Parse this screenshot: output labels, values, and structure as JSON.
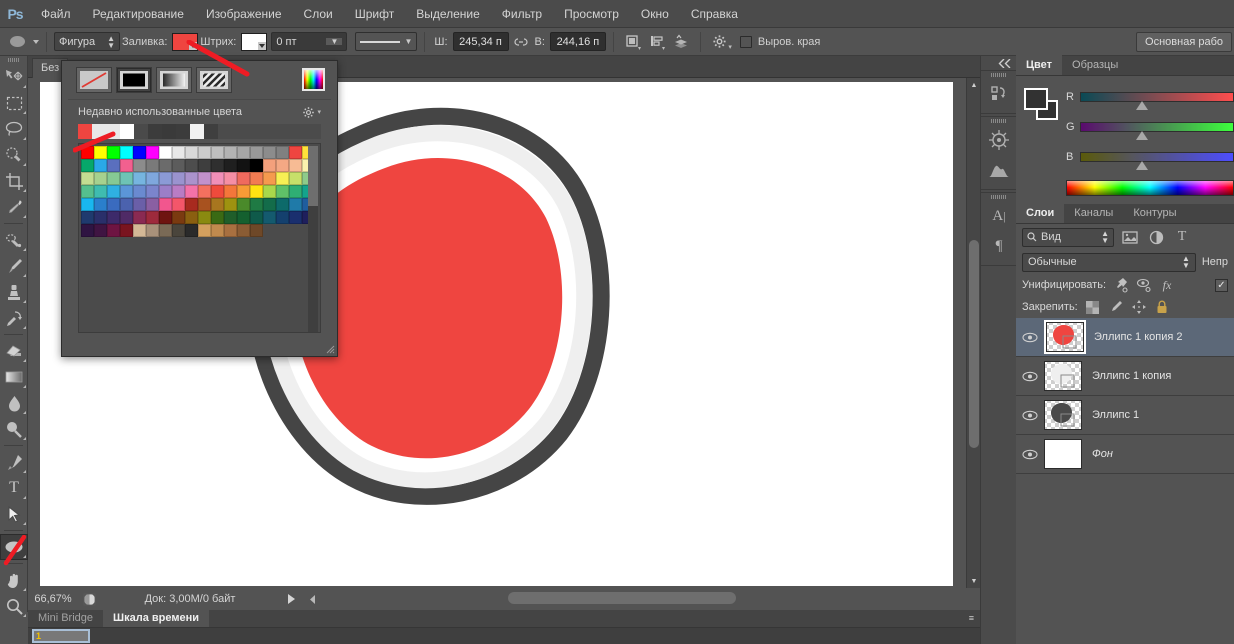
{
  "app": {
    "logo": "Ps"
  },
  "menubar": {
    "items": [
      {
        "label": "Файл"
      },
      {
        "label": "Редактирование"
      },
      {
        "label": "Изображение"
      },
      {
        "label": "Слои"
      },
      {
        "label": "Шрифт"
      },
      {
        "label": "Выделение"
      },
      {
        "label": "Фильтр"
      },
      {
        "label": "Просмотр"
      },
      {
        "label": "Окно"
      },
      {
        "label": "Справка"
      }
    ]
  },
  "options": {
    "tool_icon": "ellipse-tool-icon",
    "mode": "Фигура",
    "fill_label": "Заливка:",
    "fill_color": "#ef4540",
    "stroke_label": "Штрих:",
    "stroke_color": "#ffffff",
    "stroke_width": "0 пт",
    "stroke_style_icon": "stroke-style-icon",
    "width_label": "Ш:",
    "width_value": "245,34 п",
    "link_icon": "link-icon",
    "height_label": "В:",
    "height_value": "244,16 п",
    "path_op_icon": "path-operations-icon",
    "align_icon": "path-align-icon",
    "arrange_icon": "path-arrange-icon",
    "gear_icon": "gear-icon",
    "align_edges_label": "Выров. края",
    "workspace": "Основная рабо"
  },
  "toolbar": {
    "tools": [
      {
        "name": "move-tool",
        "glyph": "move"
      },
      {
        "name": "marquee-tool",
        "glyph": "marquee"
      },
      {
        "name": "lasso-tool",
        "glyph": "lasso"
      },
      {
        "name": "quick-selection-tool",
        "glyph": "quickselect"
      },
      {
        "name": "crop-tool",
        "glyph": "crop"
      },
      {
        "name": "eyedropper-tool",
        "glyph": "eyedropper"
      },
      {
        "name": "healing-brush-tool",
        "glyph": "healing"
      },
      {
        "name": "brush-tool",
        "glyph": "brush"
      },
      {
        "name": "clone-stamp-tool",
        "glyph": "stamp"
      },
      {
        "name": "history-brush-tool",
        "glyph": "historybrush"
      },
      {
        "name": "eraser-tool",
        "glyph": "eraser"
      },
      {
        "name": "gradient-tool",
        "glyph": "gradient"
      },
      {
        "name": "blur-tool",
        "glyph": "blur"
      },
      {
        "name": "dodge-tool",
        "glyph": "dodge"
      },
      {
        "name": "pen-tool",
        "glyph": "pen"
      },
      {
        "name": "type-tool",
        "glyph": "type"
      },
      {
        "name": "path-selection-tool",
        "glyph": "pathselect"
      },
      {
        "name": "ellipse-tool",
        "glyph": "ellipse",
        "active": true
      },
      {
        "name": "hand-tool",
        "glyph": "hand"
      },
      {
        "name": "zoom-tool",
        "glyph": "zoom"
      }
    ]
  },
  "document": {
    "tab_title": "Без",
    "canvas_bg": "#ffffff",
    "shape": {
      "outer_ring_color": "#454545",
      "mid_ring_color": "#efefef",
      "inner_fill_color": "#ef4540"
    }
  },
  "statusbar": {
    "zoom": "66,67%",
    "preview_icon": "doc-preview-icon",
    "doc_info": "Док: 3,00М/0 байт",
    "play_icon": "play-icon",
    "more_icon": "more-icon"
  },
  "rail": {
    "collapse_icon": "collapse-panels-icon",
    "groups": [
      {
        "icons": [
          {
            "name": "history-icon"
          }
        ]
      },
      {
        "icons": [
          {
            "name": "navigator-icon"
          },
          {
            "name": "histogram-icon"
          }
        ]
      },
      {
        "icons": [
          {
            "name": "character-icon",
            "glyph": "A"
          },
          {
            "name": "paragraph-icon",
            "glyph": "¶"
          }
        ]
      }
    ]
  },
  "color_panel": {
    "tabs": [
      {
        "label": "Цвет",
        "selected": true
      },
      {
        "label": "Образцы",
        "selected": false
      }
    ],
    "foreground": "#323232",
    "background": "#323232",
    "sliders": [
      {
        "label": "R",
        "pos": 36
      },
      {
        "label": "G",
        "pos": 36
      },
      {
        "label": "B",
        "pos": 36
      }
    ]
  },
  "layers_panel": {
    "tabs": [
      {
        "label": "Слои",
        "selected": true
      },
      {
        "label": "Каналы",
        "selected": false
      },
      {
        "label": "Контуры",
        "selected": false
      }
    ],
    "filter_label": "Вид",
    "filter_icons": [
      "image-filter-icon",
      "adjustment-filter-icon",
      "type-filter-icon"
    ],
    "blend_mode": "Обычные",
    "opacity_label": "Непр",
    "unify_label": "Унифицировать:",
    "unify_icons": [
      "unify-position-icon",
      "unify-visibility-icon",
      "unify-style-icon"
    ],
    "lock_label": "Закрепить:",
    "lock_icons": [
      "lock-transparency-icon",
      "lock-paint-icon",
      "lock-position-icon",
      "lock-all-icon"
    ],
    "layers": [
      {
        "name": "Эллипс 1 копия 2",
        "selected": true,
        "thumb": "red",
        "visible": true,
        "italic": false
      },
      {
        "name": "Эллипс 1 копия",
        "selected": false,
        "thumb": "white",
        "visible": true,
        "italic": false
      },
      {
        "name": "Эллипс 1",
        "selected": false,
        "thumb": "dark",
        "visible": true,
        "italic": false
      },
      {
        "name": "Фон",
        "selected": false,
        "thumb": "bg",
        "visible": true,
        "italic": true
      }
    ]
  },
  "color_popup": {
    "buttons": [
      {
        "name": "no-fill-button",
        "type": "none",
        "active": false
      },
      {
        "name": "solid-color-button",
        "type": "solid",
        "active": true
      },
      {
        "name": "gradient-button",
        "type": "gradient",
        "active": false
      },
      {
        "name": "pattern-button",
        "type": "pattern",
        "active": false
      }
    ],
    "picker_icon": "color-picker-icon",
    "recent_title": "Недавно использованные цвета",
    "gear_icon": "gear-icon",
    "recent_colors": [
      "#ef4540",
      "#e8e8e8",
      "#e8e8e8",
      "#ffffff",
      "#4a4a4a",
      "#3c3c3c",
      "#3a3a3a",
      "#3c3c3c",
      "#f2f2f2",
      "#3f3f3f"
    ],
    "swatch_rows": [
      [
        "#ff0000",
        "#ffff00",
        "#00ff00",
        "#00ffff",
        "#0000ff",
        "#ff00ff",
        "#ffffff",
        "#e8e8e8",
        "#d8d8d8",
        "#cccccc",
        "#bfbfbf",
        "#b3b3b3",
        "#a6a6a6",
        "#999999",
        "#8c8c8c",
        "#808080",
        "#ef4540",
        "#ffe13a"
      ],
      [
        "#06a86a",
        "#2aa8e8",
        "#5a6fbe",
        "#f2608f",
        "#8c8c8c",
        "#7a7a7a",
        "#6b6b6b",
        "#5c5c5c",
        "#4d4d4d",
        "#3e3e3e",
        "#2f2f2f",
        "#1f1f1f",
        "#121212",
        "#000000",
        "#f4a07c",
        "#f4a884",
        "#f7bb94",
        "#fbf2ae"
      ],
      [
        "#c3dd92",
        "#a6d18f",
        "#86c994",
        "#6ec3b5",
        "#76b5e0",
        "#7fa7dd",
        "#8b9ad6",
        "#9a93cf",
        "#ab92cc",
        "#c291cb",
        "#f08fb8",
        "#f58ea4",
        "#ef6a5e",
        "#f27c52",
        "#f59a4e",
        "#f7ef54",
        "#c7e06a",
        "#8ecb8a"
      ],
      [
        "#55bf8e",
        "#3fbcb0",
        "#2fb0e2",
        "#5b96d8",
        "#6a8ad0",
        "#7b84cc",
        "#9b7ec8",
        "#b97cc4",
        "#f472a8",
        "#f4705f",
        "#ef4a3c",
        "#f4763a",
        "#f79b36",
        "#ffe312",
        "#a9d84b",
        "#5fc168",
        "#2fae74",
        "#14a38c"
      ],
      [
        "#19b7ef",
        "#2a7fcc",
        "#3a6bbf",
        "#4b62ae",
        "#6a5fa8",
        "#8a5fa2",
        "#f2568e",
        "#f4566a",
        "#a82a1f",
        "#a8521f",
        "#a8761f",
        "#9e9210",
        "#4a8a2a",
        "#1f7a44",
        "#136c4a",
        "#0d6a6a",
        "#1f7aa8",
        "#1f5d9e"
      ],
      [
        "#1f3a6e",
        "#2a2f6a",
        "#3d2a6a",
        "#4f2a66",
        "#8a2a52",
        "#9e2a3c",
        "#6e1410",
        "#7a3a10",
        "#8a5f10",
        "#8a8a10",
        "#3a6a14",
        "#1f5e2a",
        "#14602f",
        "#0f5a4a",
        "#145a6e",
        "#14406e",
        "#1a2f6e",
        "#1f1f5c"
      ],
      [
        "#2f1442",
        "#3f1442",
        "#6e1442",
        "#7a141f",
        "#d4b896",
        "#a8917a",
        "#7a6a56",
        "#4a453c",
        "#2a2a2a",
        "#d4a05e",
        "#c08a4e",
        "#a87040",
        "#8a5c34",
        "#6e4828",
        "",
        "",
        "",
        ""
      ]
    ],
    "resize_icon": "resize-grip-icon"
  },
  "bottom_panel": {
    "tabs": [
      {
        "label": "Mini Bridge",
        "selected": false
      },
      {
        "label": "Шкала времени",
        "selected": true
      }
    ],
    "close_icon": "panel-menu-icon",
    "frame_number": "1"
  }
}
